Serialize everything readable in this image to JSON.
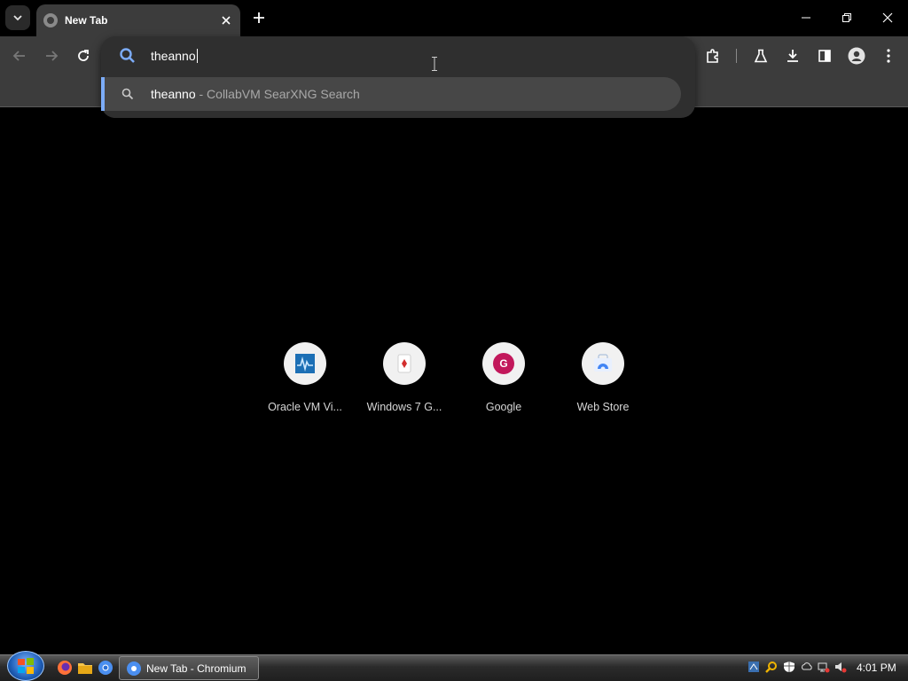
{
  "tab": {
    "title": "New Tab"
  },
  "omnibox": {
    "input_value": "theanno",
    "suggestion_query": "theanno",
    "suggestion_rest": " - CollabVM SearXNG Search"
  },
  "shortcuts": [
    {
      "label": "Oracle VM Vi..."
    },
    {
      "label": "Windows 7 G..."
    },
    {
      "label": "Google",
      "icon_letter": "G"
    },
    {
      "label": "Web Store"
    }
  ],
  "taskbar": {
    "task_label": "New Tab - Chromium",
    "clock": "4:01 PM"
  },
  "colors": {
    "accent": "#7cacf8",
    "toolbar": "#3c3c3c",
    "google_badge": "#c2185b"
  }
}
